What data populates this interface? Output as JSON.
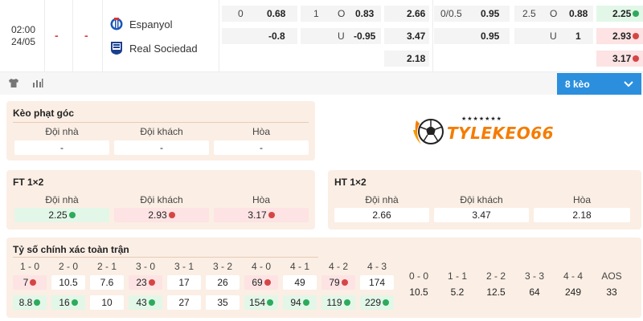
{
  "match": {
    "time": "02:00",
    "date": "24/05",
    "score_home": "-",
    "score_away": "-",
    "home_team": "Espanyol",
    "away_team": "Real Sociedad",
    "handicap_full": {
      "row1": {
        "line": "0",
        "value": "0.68"
      },
      "row2": {
        "value": "-0.8"
      }
    },
    "ou_full": {
      "row1": {
        "line": "1",
        "side": "O",
        "value": "0.83"
      },
      "row2": {
        "side": "U",
        "value": "-0.95"
      }
    },
    "x12_full": [
      "2.66",
      "3.47",
      "2.18"
    ],
    "handicap_half": {
      "row1": {
        "line": "0/0.5",
        "value": "0.95"
      },
      "row2": {
        "value": "0.95"
      }
    },
    "ou_half": {
      "row1": {
        "line": "2.5",
        "side": "O",
        "value": "0.88"
      },
      "row2": {
        "side": "U",
        "value": "1"
      }
    },
    "x12_half": [
      "2.25",
      "2.93",
      "3.17"
    ]
  },
  "toolbar": {
    "more_odds_label": "8 kèo",
    "icons": [
      "shirt-icon",
      "stats-icon",
      "chevron-down-icon"
    ]
  },
  "brand": {
    "name": "TYLEKEO66",
    "stars": "★★★★★★★"
  },
  "corner_panel": {
    "title": "Kèo phạt góc",
    "headers": [
      "Đội nhà",
      "Đội khách",
      "Hòa"
    ],
    "values": [
      "-",
      "-",
      "-"
    ]
  },
  "ft_panel": {
    "title": "FT 1×2",
    "headers": [
      "Đội nhà",
      "Đội khách",
      "Hòa"
    ],
    "values": [
      "2.25",
      "2.93",
      "3.17"
    ],
    "trends": [
      "up",
      "down",
      "down"
    ]
  },
  "ht_panel": {
    "title": "HT 1×2",
    "headers": [
      "Đội nhà",
      "Đội khách",
      "Hòa"
    ],
    "values": [
      "2.66",
      "3.47",
      "2.18"
    ]
  },
  "score_panel": {
    "title": "Tỷ số chính xác toàn trận",
    "home_scores": [
      "1 - 0",
      "2 - 0",
      "2 - 1",
      "3 - 0",
      "3 - 1",
      "3 - 2",
      "4 - 0",
      "4 - 1",
      "4 - 2",
      "4 - 3"
    ],
    "home_values": [
      "7",
      "10.5",
      "7.6",
      "23",
      "17",
      "26",
      "69",
      "49",
      "79",
      "174"
    ],
    "home_trends": [
      "down",
      "none",
      "none",
      "down",
      "none",
      "none",
      "down",
      "none",
      "down",
      "none"
    ],
    "away_values": [
      "8.8",
      "16",
      "10",
      "43",
      "27",
      "35",
      "154",
      "94",
      "119",
      "229"
    ],
    "away_trends": [
      "up",
      "up",
      "none",
      "up",
      "none",
      "none",
      "up",
      "up",
      "up",
      "up"
    ],
    "draw_scores": [
      "0 - 0",
      "1 - 1",
      "2 - 2",
      "3 - 3",
      "4 - 4",
      "AOS"
    ],
    "draw_values": [
      "10.5",
      "5.2",
      "12.5",
      "64",
      "249",
      "33"
    ]
  },
  "colors": {
    "accent": "#2b8fde",
    "panel": "#fbeee4",
    "up": "#2eaa5c",
    "down": "#d64545",
    "brand": "#f57c00"
  }
}
